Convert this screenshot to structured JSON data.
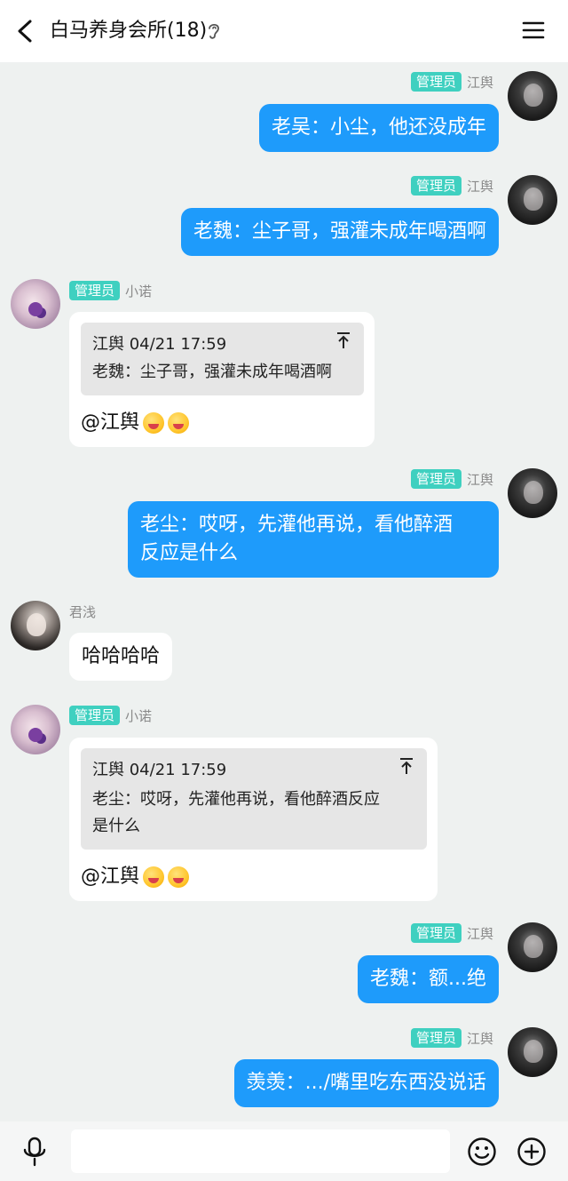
{
  "header": {
    "title": "白马养身会所(18)"
  },
  "admin_badge": "管理员",
  "messages": [
    {
      "nick": "江舆",
      "text": "老吴：小尘，他还没成年"
    },
    {
      "nick": "江舆",
      "text": "老魏：尘子哥，强灌未成年喝酒啊"
    },
    {
      "nick": "小诺",
      "quote_head": "江舆 04/21 17:59",
      "quote_lines": [
        "老魏：尘子哥，强灌未成年喝酒啊"
      ],
      "mention": "@江舆"
    },
    {
      "nick": "江舆",
      "lines": [
        "老尘：哎呀，先灌他再说，看他醉酒",
        "反应是什么"
      ]
    },
    {
      "nick": "君浅",
      "text": "哈哈哈哈"
    },
    {
      "nick": "小诺",
      "quote_head": "江舆 04/21 17:59",
      "quote_lines": [
        "老尘：哎呀，先灌他再说，看他醉酒反应",
        "是什么"
      ],
      "mention": "@江舆"
    },
    {
      "nick": "江舆",
      "text": "老魏：额...绝"
    },
    {
      "nick": "江舆",
      "text": "羡羡：.../嘴里吃东西没说话"
    }
  ],
  "input": {
    "value": ""
  },
  "icons": {
    "back": "back-arrow-icon",
    "ear": "ear-icon",
    "menu": "hamburger-menu-icon",
    "mic": "microphone-icon",
    "emoji": "smiley-icon",
    "plus": "plus-icon",
    "quote_up": "scroll-to-quoted-icon"
  },
  "colors": {
    "outgoing_bubble": "#1e9bfb",
    "admin_badge": "#3fd0c0",
    "background": "#eef1f0"
  }
}
